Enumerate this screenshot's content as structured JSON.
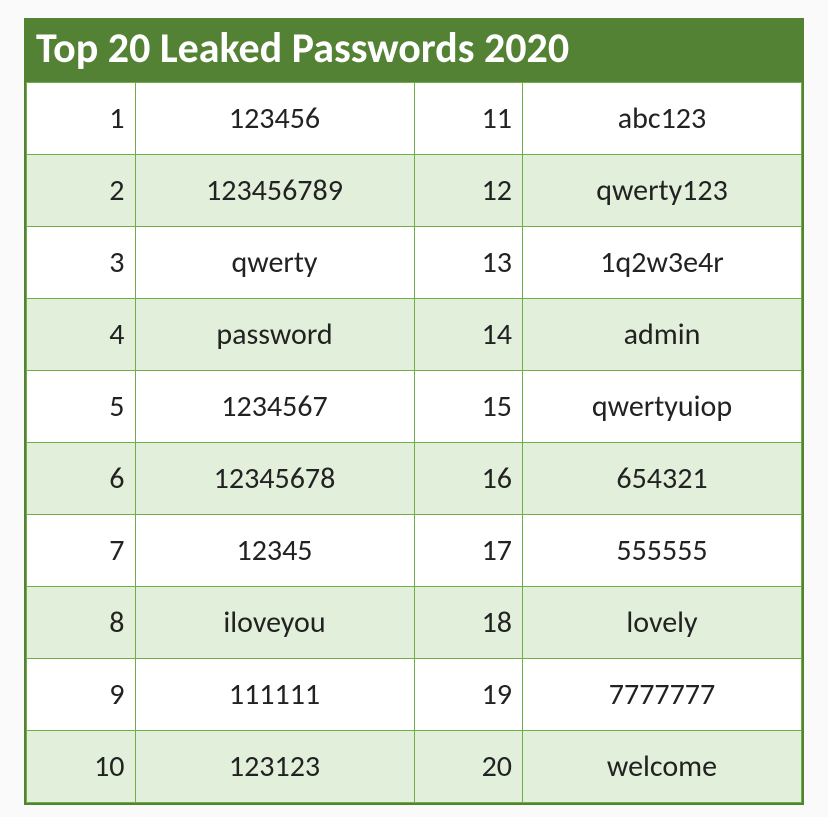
{
  "title": "Top 20 Leaked Passwords 2020",
  "rows": [
    {
      "rankA": "1",
      "pwA": "123456",
      "rankB": "11",
      "pwB": "abc123"
    },
    {
      "rankA": "2",
      "pwA": "123456789",
      "rankB": "12",
      "pwB": "qwerty123"
    },
    {
      "rankA": "3",
      "pwA": "qwerty",
      "rankB": "13",
      "pwB": "1q2w3e4r"
    },
    {
      "rankA": "4",
      "pwA": "password",
      "rankB": "14",
      "pwB": "admin"
    },
    {
      "rankA": "5",
      "pwA": "1234567",
      "rankB": "15",
      "pwB": "qwertyuiop"
    },
    {
      "rankA": "6",
      "pwA": "12345678",
      "rankB": "16",
      "pwB": "654321"
    },
    {
      "rankA": "7",
      "pwA": "12345",
      "rankB": "17",
      "pwB": "555555"
    },
    {
      "rankA": "8",
      "pwA": "iloveyou",
      "rankB": "18",
      "pwB": "lovely"
    },
    {
      "rankA": "9",
      "pwA": "111111",
      "rankB": "19",
      "pwB": "7777777"
    },
    {
      "rankA": "10",
      "pwA": "123123",
      "rankB": "20",
      "pwB": "welcome"
    }
  ]
}
